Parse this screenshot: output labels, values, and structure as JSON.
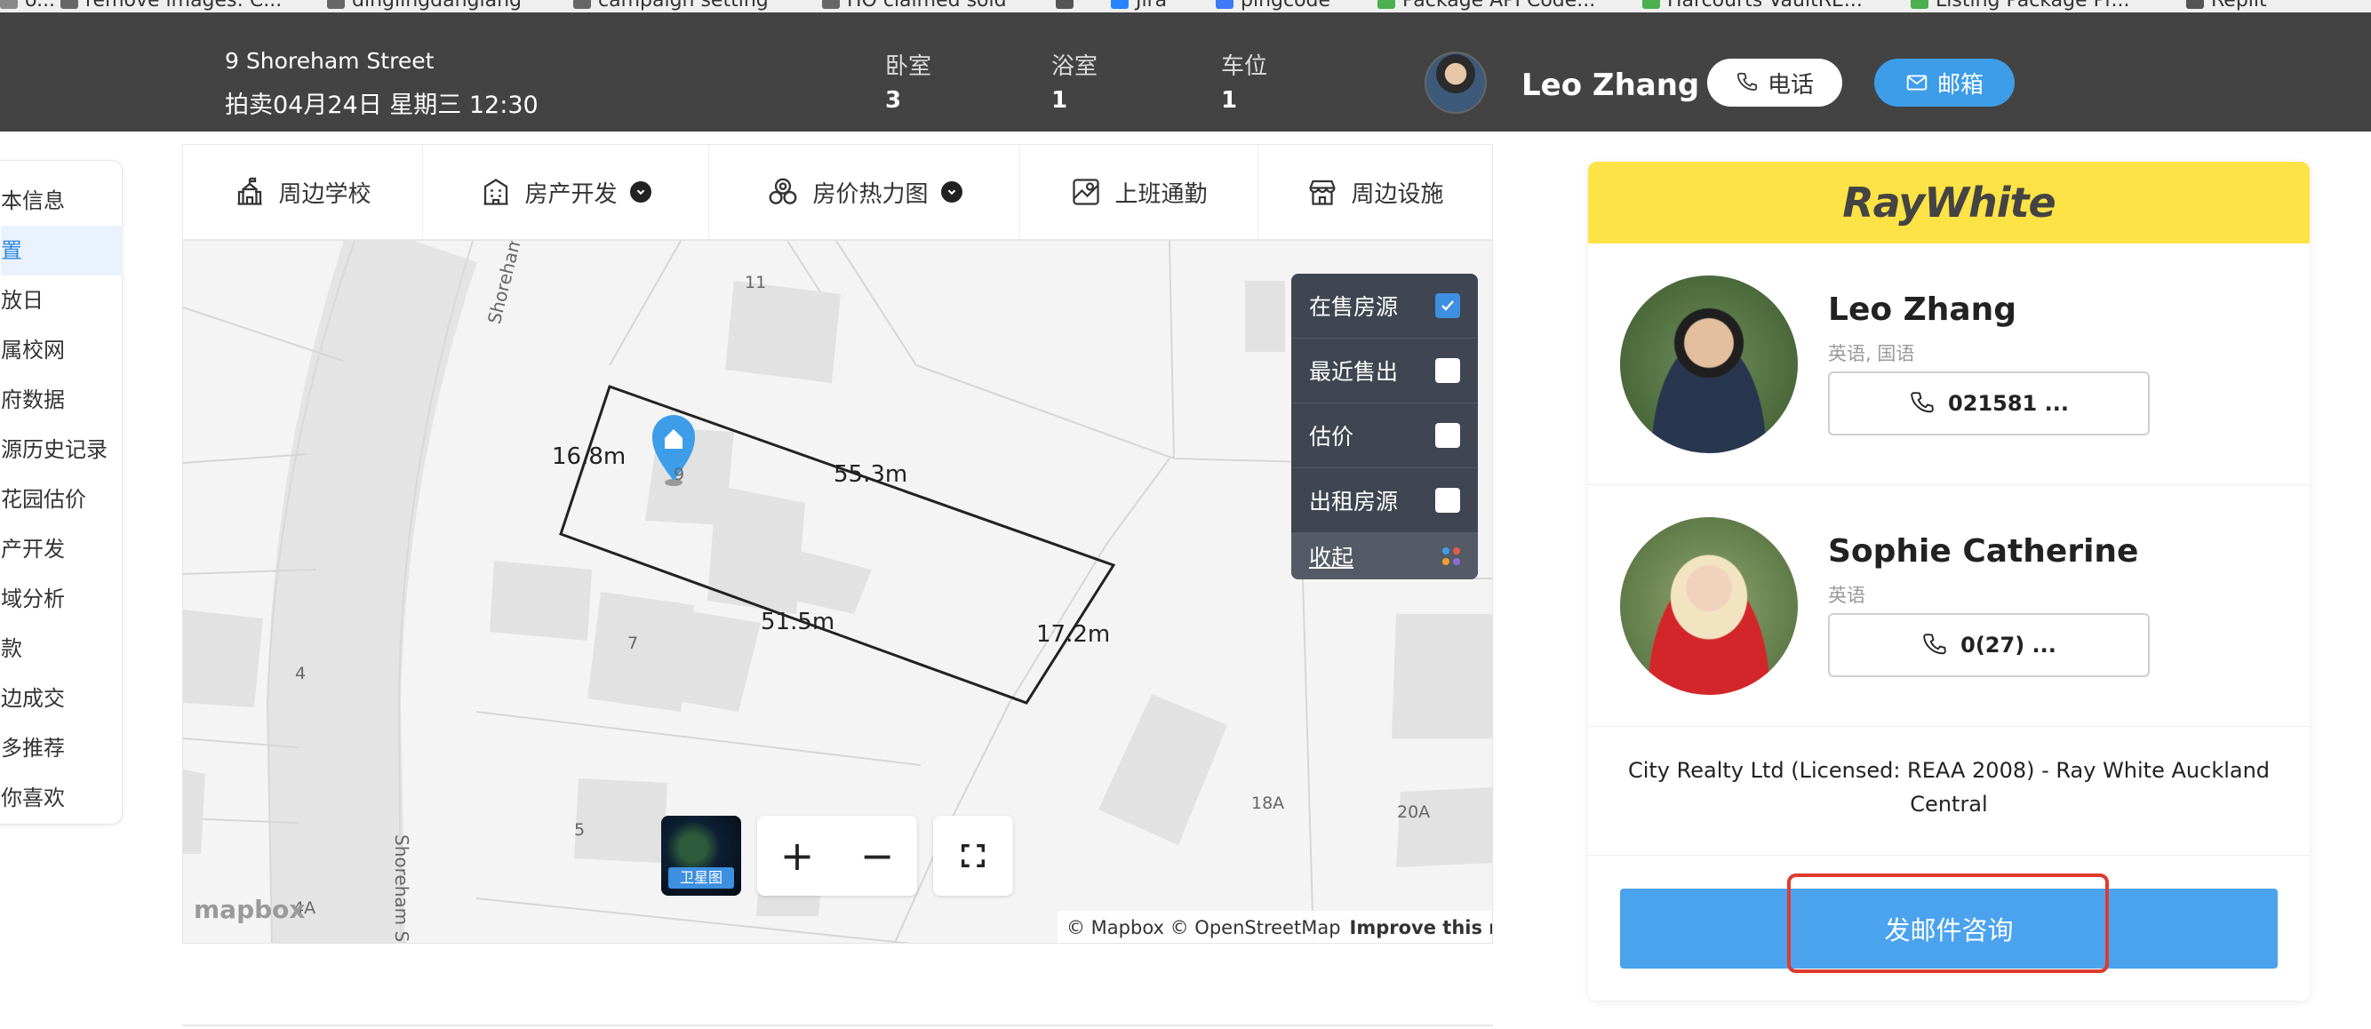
{
  "bookmarks": [
    {
      "label": "o...",
      "color": "#888"
    },
    {
      "label": "remove images: C...",
      "color": "#666"
    },
    {
      "label": "dinglingdanglang",
      "color": "#666"
    },
    {
      "label": "campaign setting",
      "color": "#666"
    },
    {
      "label": "HO claimed sold",
      "color": "#666"
    },
    {
      "label": "",
      "color": "#555"
    },
    {
      "label": "Jira",
      "color": "#2684ff"
    },
    {
      "label": "pingcode",
      "color": "#3d7af5"
    },
    {
      "label": "Package API Code...",
      "color": "#4caf50"
    },
    {
      "label": "Harcourts VaultRE...",
      "color": "#4caf50"
    },
    {
      "label": "Listing Package Pr...",
      "color": "#4caf50"
    },
    {
      "label": "Replit",
      "color": "#555"
    }
  ],
  "header": {
    "address": "9 Shoreham Street",
    "auction": "拍卖04月24日 星期三 12:30",
    "stats": [
      {
        "label": "卧室",
        "value": "3"
      },
      {
        "label": "浴室",
        "value": "1"
      },
      {
        "label": "车位",
        "value": "1"
      }
    ],
    "agent_name": "Leo Zhang",
    "phone_label": "电话",
    "email_label": "邮箱"
  },
  "sidenav": {
    "items": [
      {
        "label": "本信息",
        "active": false
      },
      {
        "label": "置",
        "active": true
      },
      {
        "label": "放日",
        "active": false
      },
      {
        "label": "属校网",
        "active": false
      },
      {
        "label": "府数据",
        "active": false
      },
      {
        "label": "源历史记录",
        "active": false
      },
      {
        "label": "花园估价",
        "active": false
      },
      {
        "label": "产开发",
        "active": false
      },
      {
        "label": "域分析",
        "active": false
      },
      {
        "label": "款",
        "active": false
      },
      {
        "label": "边成交",
        "active": false
      },
      {
        "label": "多推荐",
        "active": false
      },
      {
        "label": "你喜欢",
        "active": false
      }
    ]
  },
  "tabs": [
    {
      "label": "周边学校",
      "icon": "school-icon",
      "dropdown": false
    },
    {
      "label": "房产开发",
      "icon": "building-icon",
      "dropdown": true
    },
    {
      "label": "房价热力图",
      "icon": "heatmap-icon",
      "dropdown": true
    },
    {
      "label": "上班通勤",
      "icon": "commute-map-icon",
      "dropdown": false
    },
    {
      "label": "周边设施",
      "icon": "store-icon",
      "dropdown": false
    }
  ],
  "map": {
    "measurements": [
      "16.8m",
      "55.3m",
      "51.5m",
      "17.2m"
    ],
    "lot_numbers": [
      "11",
      "9",
      "7",
      "4",
      "5",
      "18A",
      "20A",
      "4A"
    ],
    "streets": [
      "Shoreham St",
      "Shoreham St"
    ],
    "layers": [
      {
        "label": "在售房源",
        "checked": true
      },
      {
        "label": "最近售出",
        "checked": false
      },
      {
        "label": "估价",
        "checked": false
      },
      {
        "label": "出租房源",
        "checked": false
      }
    ],
    "collapse_label": "收起",
    "satellite_label": "卫星图",
    "zoom_in": "+",
    "zoom_out": "−",
    "mapbox_logo": "mapbox",
    "attribution": "© Mapbox © OpenStreetMap",
    "improve_link": "Improve this map"
  },
  "card": {
    "brand": "RayWhite",
    "agents": [
      {
        "name": "Leo Zhang",
        "languages": "英语, 国语",
        "phone": "021581 ..."
      },
      {
        "name": "Sophie Catherine",
        "languages": "英语",
        "phone": "0(27) ..."
      }
    ],
    "office": "City Realty Ltd (Licensed: REAA 2008) - Ray White Auckland Central",
    "email_button": "发邮件咨询"
  },
  "colors": {
    "header_bg": "#434343",
    "accent_blue": "#3d9de8",
    "brand_yellow": "#fde345",
    "highlight_red": "#e03a2f"
  }
}
